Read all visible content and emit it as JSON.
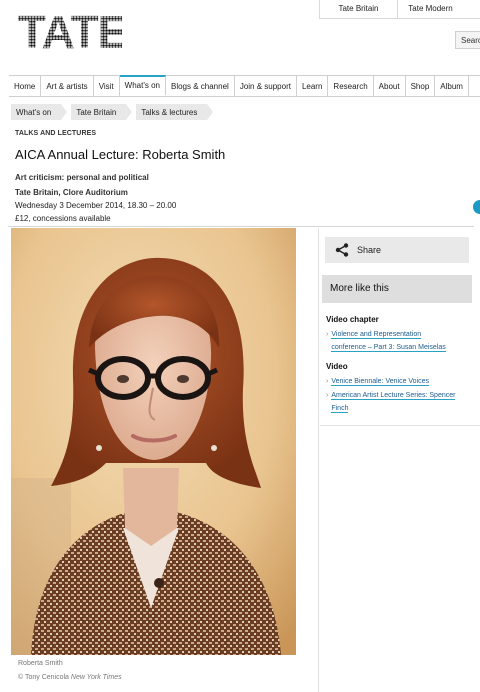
{
  "header": {
    "logo_text": "TATE",
    "top_links": [
      "Tate Britain",
      "Tate Modern"
    ],
    "search_label": "Search"
  },
  "nav": {
    "items": [
      "Home",
      "Art & artists",
      "Visit",
      "What's on",
      "Blogs & channel",
      "Join & support",
      "Learn",
      "Research",
      "About",
      "Shop",
      "Album"
    ],
    "active": "What's on"
  },
  "breadcrumb": [
    "What's on",
    "Tate Britain",
    "Talks & lectures"
  ],
  "event": {
    "section": "TALKS AND LECTURES",
    "title": "AICA Annual Lecture: Roberta Smith",
    "subtitle": "Art criticism: personal and political",
    "venue": "Tate Britain, Clore Auditorium",
    "date": "Wednesday 3 December 2014, 18.30 – 20.00",
    "price": "£12, concessions available"
  },
  "photo": {
    "caption": "Roberta Smith",
    "credit_prefix": "© Tony Cenicola ",
    "credit_source": "New York Times"
  },
  "sidebar": {
    "share_label": "Share",
    "more_like_this": "More like this",
    "groups": [
      {
        "heading": "Video chapter",
        "links": [
          "Violence and Representation",
          "conference – Part 3: Susan Meiselas"
        ]
      },
      {
        "heading": "Video",
        "links": [
          "Venice Biennale: Venice Voices",
          "American Artist Lecture Series: Spencer",
          "Finch"
        ]
      }
    ]
  },
  "colors": {
    "accent": "#2aa1c7",
    "link": "#1d5c8f"
  }
}
